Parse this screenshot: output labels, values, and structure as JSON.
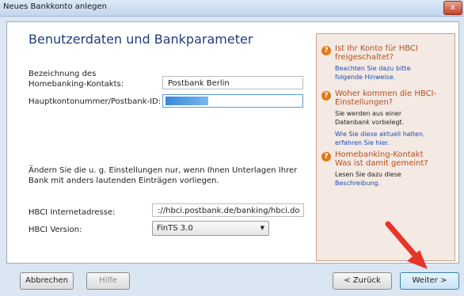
{
  "window": {
    "title": "Neues Bankkonto anlegen",
    "close_label": "x"
  },
  "form": {
    "heading": "Benutzerdaten und Bankparameter",
    "contact_label_line1": "Bezeichnung des",
    "contact_label_line2": "Homebanking-Kontakts:",
    "contact_value": "Postbank Berlin",
    "account_label": "Hauptkontonummer/Postbank-ID:",
    "account_value": "",
    "notice_line1": "Ändern Sie die u. g. Einstellungen nur, wenn Ihnen Unterlagen Ihrer",
    "notice_line2": "Bank mit anders lautenden Einträgen vorliegen.",
    "hbci_address_label": "HBCI Internetadresse:",
    "hbci_address_value": "://hbci.postbank.de/banking/hbci.do",
    "hbci_version_label": "HBCI Version:",
    "hbci_version_value": "FinTS 3.0"
  },
  "info": [
    {
      "head1": "Ist Ihr Konto für HBCI",
      "head2": "freigeschaltet?",
      "text1": "",
      "text2": "",
      "link1": "Beachten Sie dazu bitte",
      "link2": "folgende Hinweise."
    },
    {
      "head1": "Woher kommen die HBCI-",
      "head2": "Einstellungen?",
      "text1": "Sie werden aus einer",
      "text2": "Datenbank vorbelegt.",
      "link1": "Wie Sie diese aktuell halten,",
      "link2": "erfahren Sie hier."
    },
    {
      "head1": "Homebanking-Kontakt",
      "head2": "Was ist damit gemeint?",
      "text1": "Lesen Sie dazu diese",
      "text2": "",
      "link1": "Beschreibung.",
      "link2": ""
    }
  ],
  "buttons": {
    "cancel": "Abbrechen",
    "help": "Hilfe",
    "back": "< Zurück",
    "next": "Weiter >"
  },
  "colors": {
    "arrow": "#e8352a",
    "heading": "#1f3d7a",
    "info_head": "#b34e1c"
  }
}
